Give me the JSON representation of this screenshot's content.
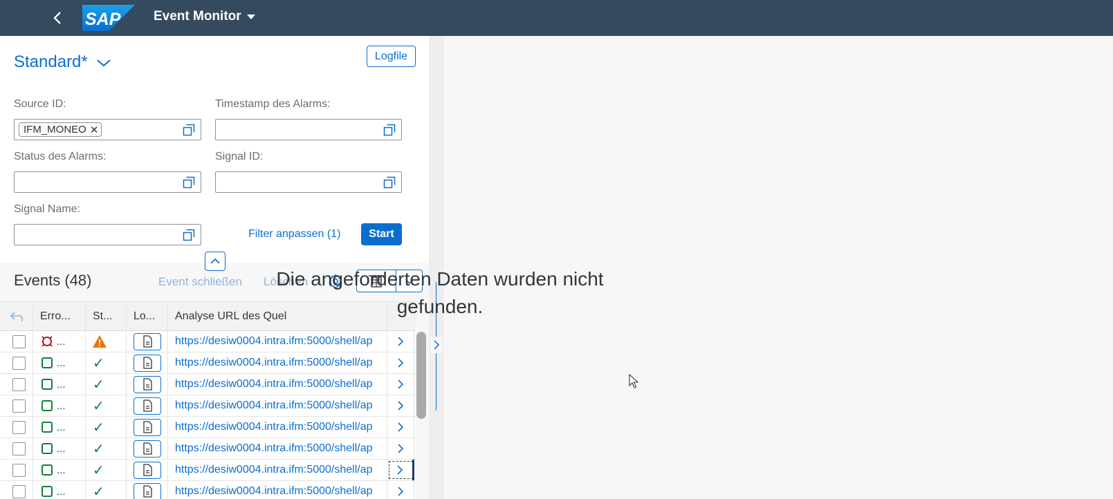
{
  "shell": {
    "app_title": "Event Monitor",
    "logo_text": "SAP",
    "colors": {
      "shell_bg": "#354a5f",
      "accent": "#0a6ed1"
    }
  },
  "filterbar": {
    "variant_name": "Standard*",
    "logfile_label": "Logfile",
    "fields": {
      "source_id": {
        "label": "Source ID:",
        "token": "IFM_MONEO"
      },
      "timestamp": {
        "label": "Timestamp des Alarms:"
      },
      "status": {
        "label": "Status des Alarms:"
      },
      "signal_id": {
        "label": "Signal ID:"
      },
      "signal_name": {
        "label": "Signal Name:"
      }
    },
    "adapt_filters_label": "Filter anpassen (1)",
    "go_label": "Start"
  },
  "table": {
    "title": "Events (48)",
    "actions": {
      "close_event": "Event schließen",
      "delete": "Löschen"
    },
    "columns": [
      "Erro...",
      "St...",
      "Lo...",
      "Analyse URL des Quel"
    ],
    "row_url": "https://desiw0004.intra.ifm:5000/shell/ap",
    "rows": [
      {
        "error_icon": "error-icon",
        "status": "warning",
        "dots": "..."
      },
      {
        "error_icon": "success-square-icon",
        "status": "success",
        "dots": "..."
      },
      {
        "error_icon": "success-square-icon",
        "status": "success",
        "dots": "..."
      },
      {
        "error_icon": "success-square-icon",
        "status": "success",
        "dots": "..."
      },
      {
        "error_icon": "success-square-icon",
        "status": "success",
        "dots": "..."
      },
      {
        "error_icon": "success-square-icon",
        "status": "success",
        "dots": "..."
      },
      {
        "error_icon": "success-square-icon",
        "status": "success",
        "dots": "..."
      },
      {
        "error_icon": "success-square-icon",
        "status": "success",
        "dots": "..."
      }
    ]
  },
  "detail": {
    "no_data_text": "Die angeforderten Daten wurden nicht gefunden."
  }
}
